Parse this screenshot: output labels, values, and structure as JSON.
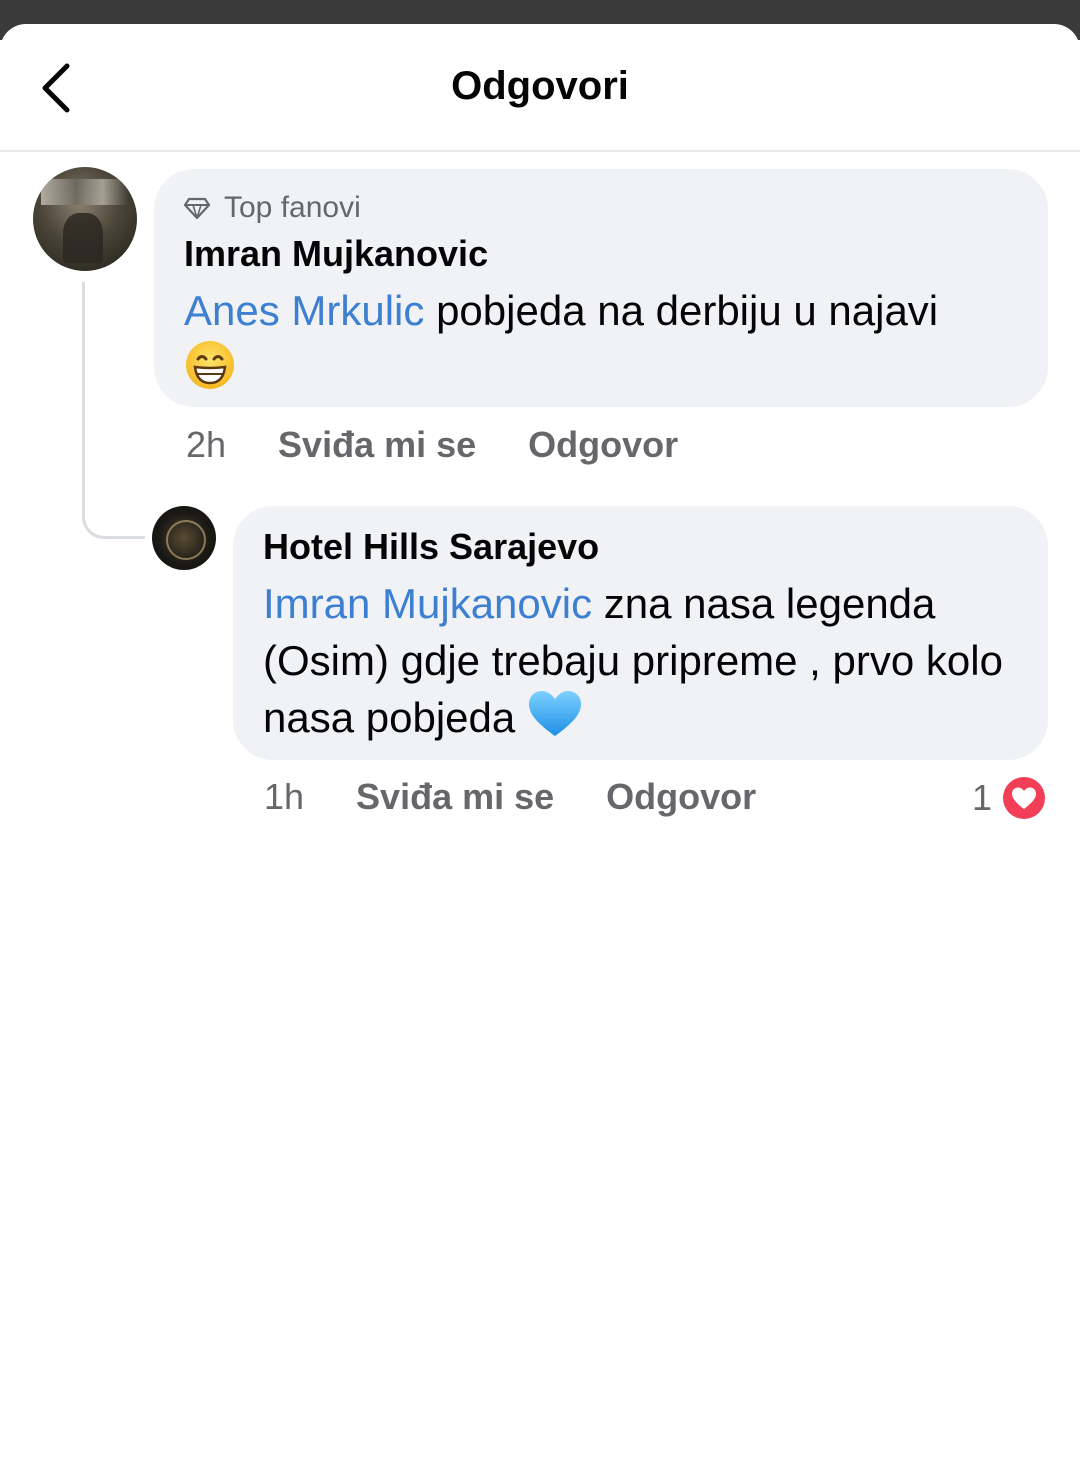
{
  "header": {
    "title": "Odgovori",
    "back_icon": "chevron-left-icon"
  },
  "comments": [
    {
      "badge": "Top fanovi",
      "badge_icon": "diamond-icon",
      "author": "Imran Mujkanovic",
      "mention": "Anes Mrkulic",
      "text": " pobjeda na derbiju u najavi",
      "emoji": "grinning-face-emoji",
      "time": "2h",
      "like_label": "Sviđa mi se",
      "reply_label": "Odgovor"
    },
    {
      "author": "Hotel Hills Sarajevo",
      "mention": "Imran Mujkanovic",
      "text": " zna nasa legenda (Osim) gdje trebaju pripreme , prvo kolo nasa pobjeda",
      "emoji": "blue-heart-emoji",
      "time": "1h",
      "like_label": "Sviđa mi se",
      "reply_label": "Odgovor",
      "reaction_count": "1",
      "reaction_icon": "love-reaction-icon"
    }
  ],
  "colors": {
    "mention": "#3d7fd1",
    "bubble": "#f0f2f5",
    "meta": "#65676b",
    "love": "#f33e58"
  }
}
